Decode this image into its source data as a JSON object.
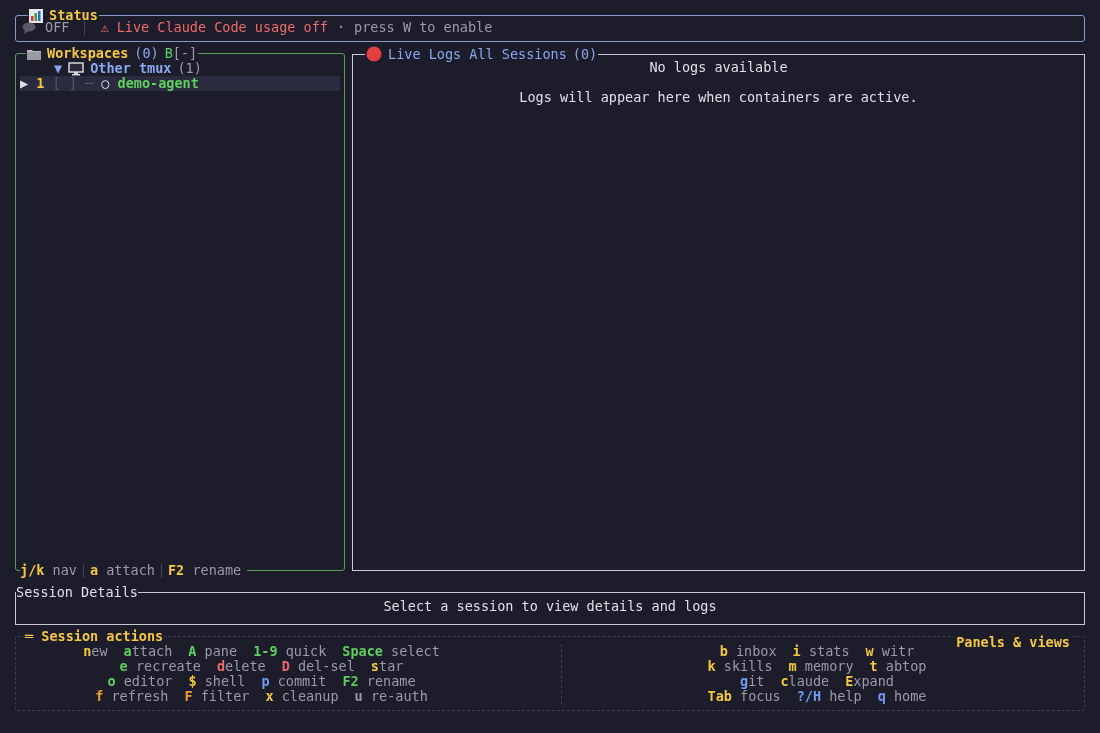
{
  "status": {
    "title": "Status",
    "usage_on": false,
    "state_label": "OFF",
    "warning": "⚠ Live Claude Code usage off",
    "separator": "·",
    "hint": "press W to enable"
  },
  "workspaces": {
    "title": "Workspaces",
    "count": "(0)",
    "badge": "B",
    "badge_state": "[-]",
    "groups": [
      {
        "toggle": "▼",
        "name": "Other tmux",
        "count": "(1)",
        "expanded": true,
        "sessions": [
          {
            "pointer": "▶",
            "index": "1",
            "checkbox": "[ ]",
            "connector": "─",
            "status_glyph": "○",
            "name": "demo-agent",
            "selected": true
          }
        ]
      }
    ],
    "footer": [
      {
        "key": "j/k",
        "label": "nav"
      },
      {
        "key": "a",
        "label": "attach"
      },
      {
        "key": "F2",
        "label": "rename"
      }
    ]
  },
  "logs": {
    "title": "Live Logs All Sessions",
    "count": "(0)",
    "empty_title": "No logs available",
    "empty_message": "Logs will appear here when containers are active."
  },
  "session_details": {
    "title": "Session Details",
    "message": "Select a session to view details and logs"
  },
  "session_actions": {
    "title": "═ Session actions",
    "lines": [
      {
        "hints": [
          {
            "key": "n",
            "label": "ew",
            "color": "#f5c842"
          },
          {
            "key": "a",
            "label": "ttach",
            "color": "#5fcf5f"
          },
          {
            "key": "A",
            "label": " pane",
            "color": "#5fcf5f"
          },
          {
            "key": "1-9",
            "label": " quick",
            "color": "#5fcf5f"
          },
          {
            "key": "Space",
            "label": " select",
            "color": "#5fcf5f"
          }
        ]
      },
      {
        "hints": [
          {
            "key": "e",
            "label": " recreate",
            "color": "#5fcf5f"
          },
          {
            "key": "d",
            "label": "elete",
            "color": "#ef6b6b"
          },
          {
            "key": "D",
            "label": " del-sel",
            "color": "#ef6b6b"
          },
          {
            "key": "s",
            "label": "tar",
            "color": "#f5c842"
          }
        ]
      },
      {
        "hints": [
          {
            "key": "o",
            "label": " editor",
            "color": "#5fcf5f"
          },
          {
            "key": "$",
            "label": " shell",
            "color": "#f5c842"
          },
          {
            "key": "p",
            "label": " commit",
            "color": "#6f9cf0"
          },
          {
            "key": "F2",
            "label": " rename",
            "color": "#5fcf5f"
          }
        ]
      },
      {
        "hints": [
          {
            "key": "f",
            "label": " refresh",
            "color": "#f0a030"
          },
          {
            "key": "F",
            "label": " filter",
            "color": "#f0a030"
          },
          {
            "key": "x",
            "label": " cleanup",
            "color": "#f5c842"
          },
          {
            "key": "u",
            "label": " re-auth",
            "color": "#9a9aa8"
          }
        ]
      }
    ]
  },
  "panels_views": {
    "title": "Panels & views",
    "lines": [
      {
        "hints": [
          {
            "key": "b",
            "label": " inbox",
            "color": "#f5c842"
          },
          {
            "key": "i",
            "label": " stats",
            "color": "#f5c842"
          },
          {
            "key": "w",
            "label": " witr",
            "color": "#f5c842"
          }
        ]
      },
      {
        "hints": [
          {
            "key": "k",
            "label": " skills",
            "color": "#f5c842"
          },
          {
            "key": "m",
            "label": " memory",
            "color": "#f5c842"
          },
          {
            "key": "t",
            "label": " abtop",
            "color": "#f5c842"
          }
        ]
      },
      {
        "hints": [
          {
            "key": "g",
            "label": "it",
            "color": "#6f9cf0"
          },
          {
            "key": "c",
            "label": "laude",
            "color": "#f5c842"
          },
          {
            "key": "E",
            "label": "xpand",
            "color": "#f5c842"
          }
        ]
      },
      {
        "hints": [
          {
            "key": "Tab",
            "label": " focus",
            "color": "#f5c842"
          },
          {
            "key": "?/H",
            "label": " help",
            "color": "#6f9cf0"
          },
          {
            "key": "q",
            "label": " home",
            "color": "#6f9cf0"
          }
        ]
      }
    ]
  }
}
